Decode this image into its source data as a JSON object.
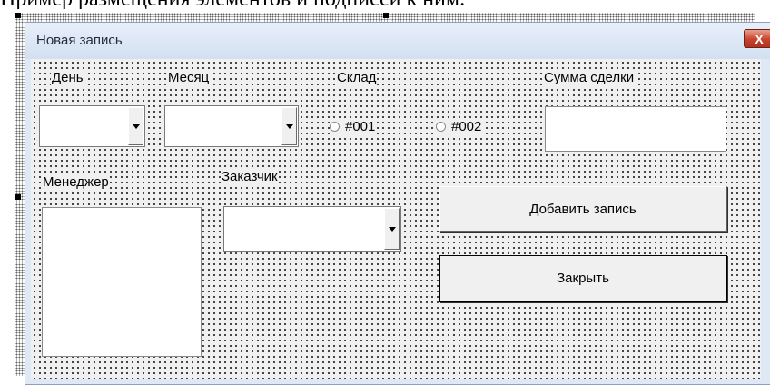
{
  "document": {
    "caption_text": "Пример размещения элементов и подписей к ним."
  },
  "window": {
    "title": "Новая запись",
    "close_glyph": "X"
  },
  "fields": {
    "day": {
      "label": "День",
      "value": ""
    },
    "month": {
      "label": "Месяц",
      "value": ""
    },
    "warehouse": {
      "label": "Склад",
      "options": [
        "#001",
        "#002"
      ]
    },
    "deal_sum": {
      "label": "Сумма сделки",
      "value": ""
    },
    "manager": {
      "label": "Менеджер",
      "items": []
    },
    "customer": {
      "label": "Заказчик",
      "value": ""
    }
  },
  "buttons": {
    "add_record": "Добавить запись",
    "close": "Закрыть"
  }
}
